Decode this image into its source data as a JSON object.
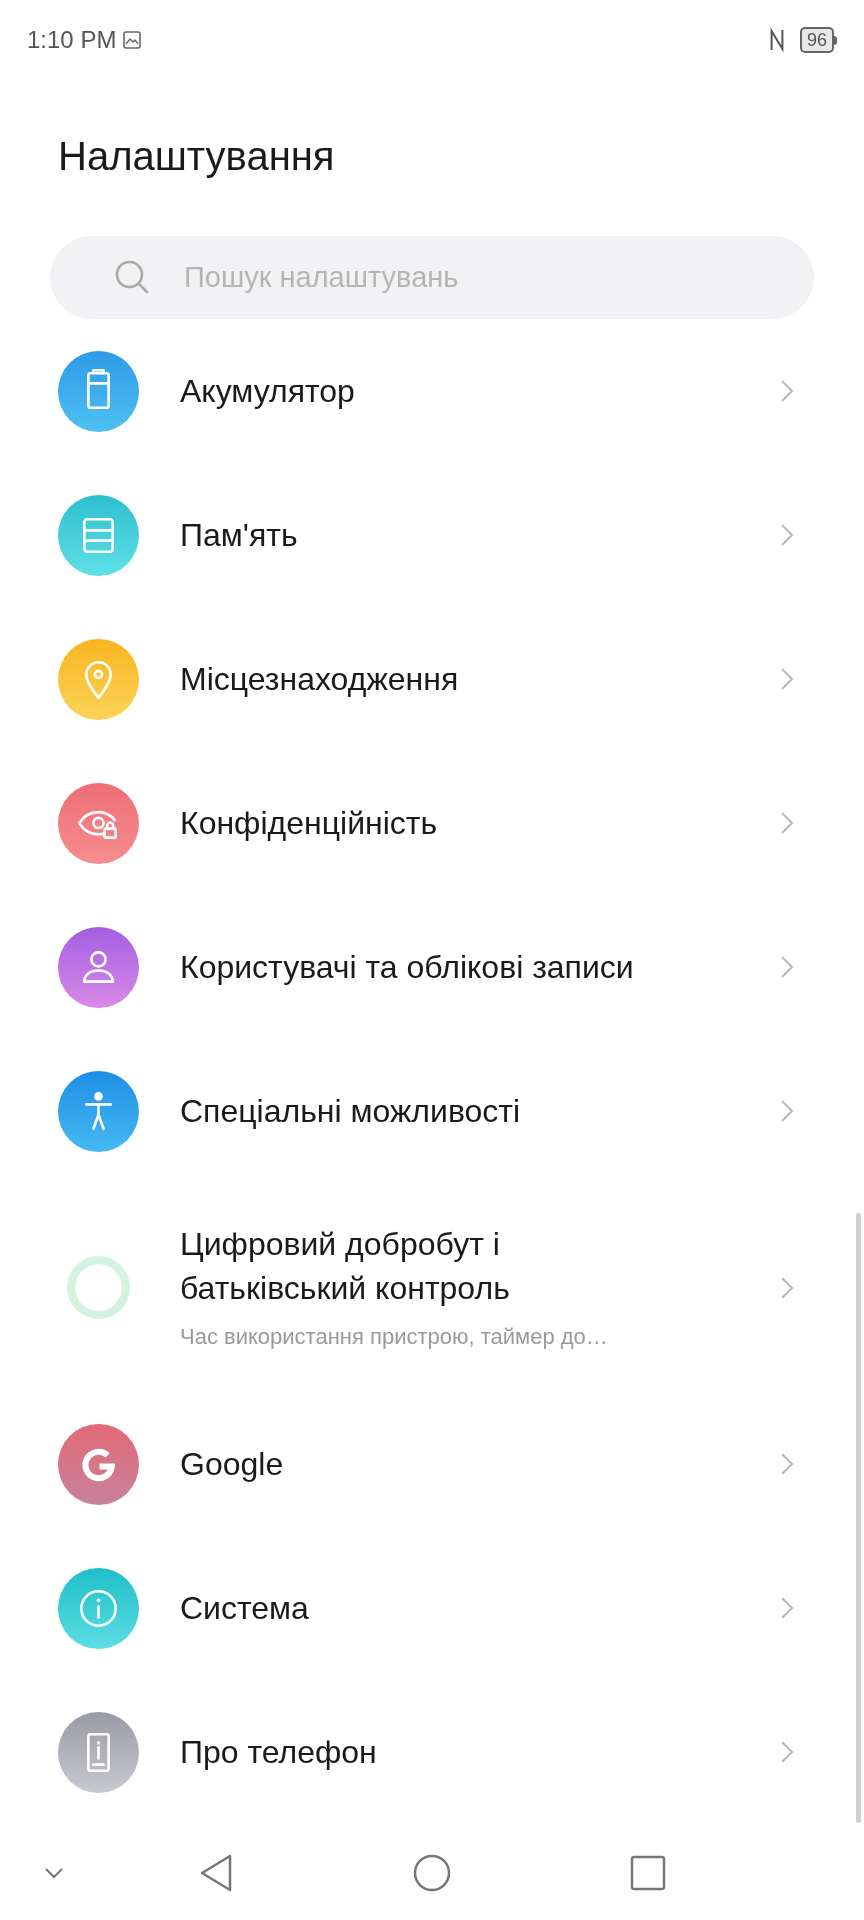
{
  "status_bar": {
    "time": "1:10 PM",
    "battery": "96"
  },
  "title": "Налаштування",
  "search": {
    "placeholder": "Пошук налаштувань"
  },
  "items": [
    {
      "kind": "battery",
      "label": "Акумулятор"
    },
    {
      "kind": "storage",
      "label": "Пам'ять"
    },
    {
      "kind": "location",
      "label": "Місцезнаходження"
    },
    {
      "kind": "privacy",
      "label": "Конфіденційність"
    },
    {
      "kind": "account",
      "label": "Користувачі та облікові записи"
    },
    {
      "kind": "accessibility",
      "label": "Спеціальні можливості"
    },
    {
      "kind": "wellbeing",
      "label": "Цифровий добробут і\nбатьківський контроль",
      "subtitle": "Час використання пристрою, таймер до…"
    },
    {
      "kind": "google",
      "label": "Google"
    },
    {
      "kind": "system",
      "label": "Система"
    },
    {
      "kind": "phone",
      "label": "Про телефон"
    }
  ]
}
